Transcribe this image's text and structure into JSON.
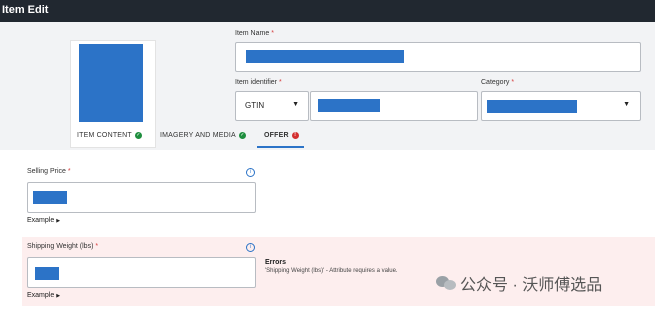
{
  "window": {
    "title": "Item Edit"
  },
  "item_name": {
    "label": "Item Name",
    "required_mark": "*"
  },
  "item_identifier": {
    "label": "Item identifier",
    "required_mark": "*",
    "type_value": "GTIN"
  },
  "category": {
    "label": "Category",
    "required_mark": "*"
  },
  "tabs": [
    {
      "label": "ITEM CONTENT",
      "status": "complete"
    },
    {
      "label": "IMAGERY AND MEDIA",
      "status": "complete"
    },
    {
      "label": "OFFER",
      "status": "error",
      "badge": "!"
    }
  ],
  "selling_price": {
    "label": "Selling Price",
    "required_mark": "*",
    "example": "Example"
  },
  "shipping_weight": {
    "label": "Shipping Weight (lbs)",
    "required_mark": "*",
    "example": "Example"
  },
  "errors": {
    "title": "Errors",
    "message": "'Shipping Weight (lbs)' - Attribute requires a value."
  },
  "icons": {
    "info": "info-icon",
    "dropdown": "caret-down-icon",
    "expand": "caret-right-icon",
    "check": "check-circle-icon"
  },
  "watermark": {
    "text": "公众号 · 沃师傅选品"
  },
  "colors": {
    "accent": "#2c73c7",
    "success": "#1e8e3e",
    "error": "#d32f2f",
    "error_bg": "#fdeeee",
    "titlebar": "#212830"
  }
}
